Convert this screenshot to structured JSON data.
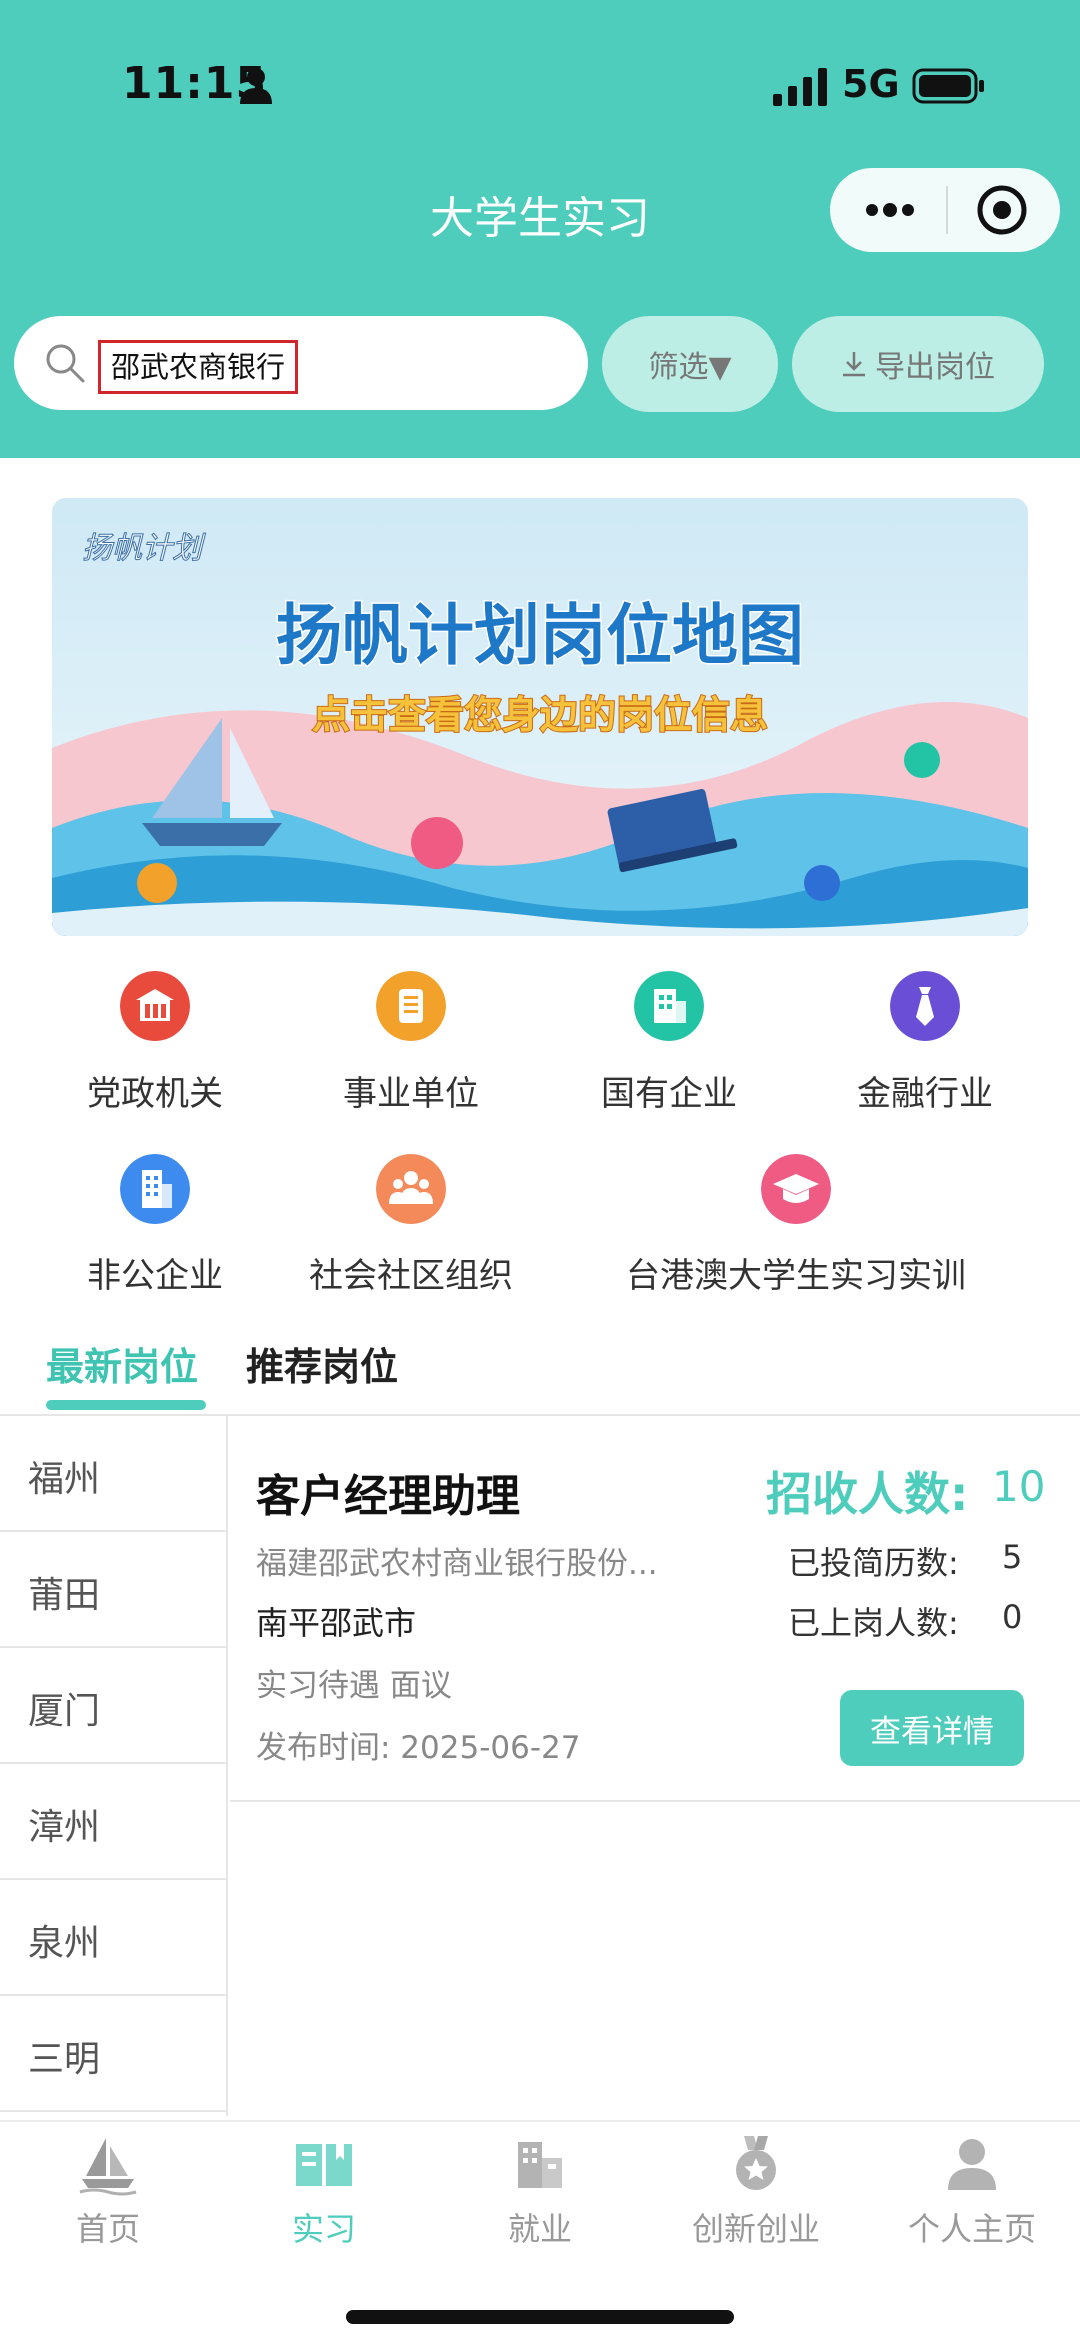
{
  "status": {
    "time": "11:15",
    "network": "5G"
  },
  "header": {
    "title": "大学生实习",
    "search_value": "邵武农商银行",
    "filter_label": "筛选▼",
    "export_label": "导出岗位"
  },
  "banner": {
    "logo_text": "扬帆计划",
    "title": "扬帆计划岗位地图",
    "subtitle": "点击查看您身边的岗位信息"
  },
  "categories": [
    {
      "label": "党政机关",
      "icon": "government-building-icon",
      "color": "#e84a3c"
    },
    {
      "label": "事业单位",
      "icon": "document-list-icon",
      "color": "#f2a12b"
    },
    {
      "label": "国有企业",
      "icon": "office-building-icon",
      "color": "#23c3a6"
    },
    {
      "label": "金融行业",
      "icon": "necktie-icon",
      "color": "#6a4fd6"
    },
    {
      "label": "非公企业",
      "icon": "tower-building-icon",
      "color": "#3d8bef"
    },
    {
      "label": "社会社区组织",
      "icon": "community-people-icon",
      "color": "#f4895a"
    },
    {
      "label": "台港澳大学生实习实训",
      "icon": "graduation-cap-icon",
      "color": "#ef5b83"
    }
  ],
  "tabs": {
    "latest": "最新岗位",
    "recommended": "推荐岗位"
  },
  "cities": [
    "福州",
    "莆田",
    "厦门",
    "漳州",
    "泉州",
    "三明"
  ],
  "job": {
    "title": "客户经理助理",
    "quota_label": "招收人数:",
    "quota_value": "10",
    "company": "福建邵武农村商业银行股份...",
    "applications_label": "已投简历数:",
    "applications_value": "5",
    "onboard_label": "已上岗人数:",
    "onboard_value": "0",
    "city": "南平邵武市",
    "salary": "实习待遇 面议",
    "publish": "发布时间: 2025-06-27",
    "detail_button": "查看详情"
  },
  "bottom_nav": [
    {
      "label": "首页",
      "icon": "sailboat-icon",
      "active": false
    },
    {
      "label": "实习",
      "icon": "open-book-icon",
      "active": true
    },
    {
      "label": "就业",
      "icon": "buildings-icon",
      "active": false
    },
    {
      "label": "创新创业",
      "icon": "medal-icon",
      "active": false
    },
    {
      "label": "个人主页",
      "icon": "user-icon",
      "active": false
    }
  ],
  "colors": {
    "theme": "#4fcdbc",
    "theme_light": "#bdeee5",
    "highlight_border": "#d0252a"
  }
}
